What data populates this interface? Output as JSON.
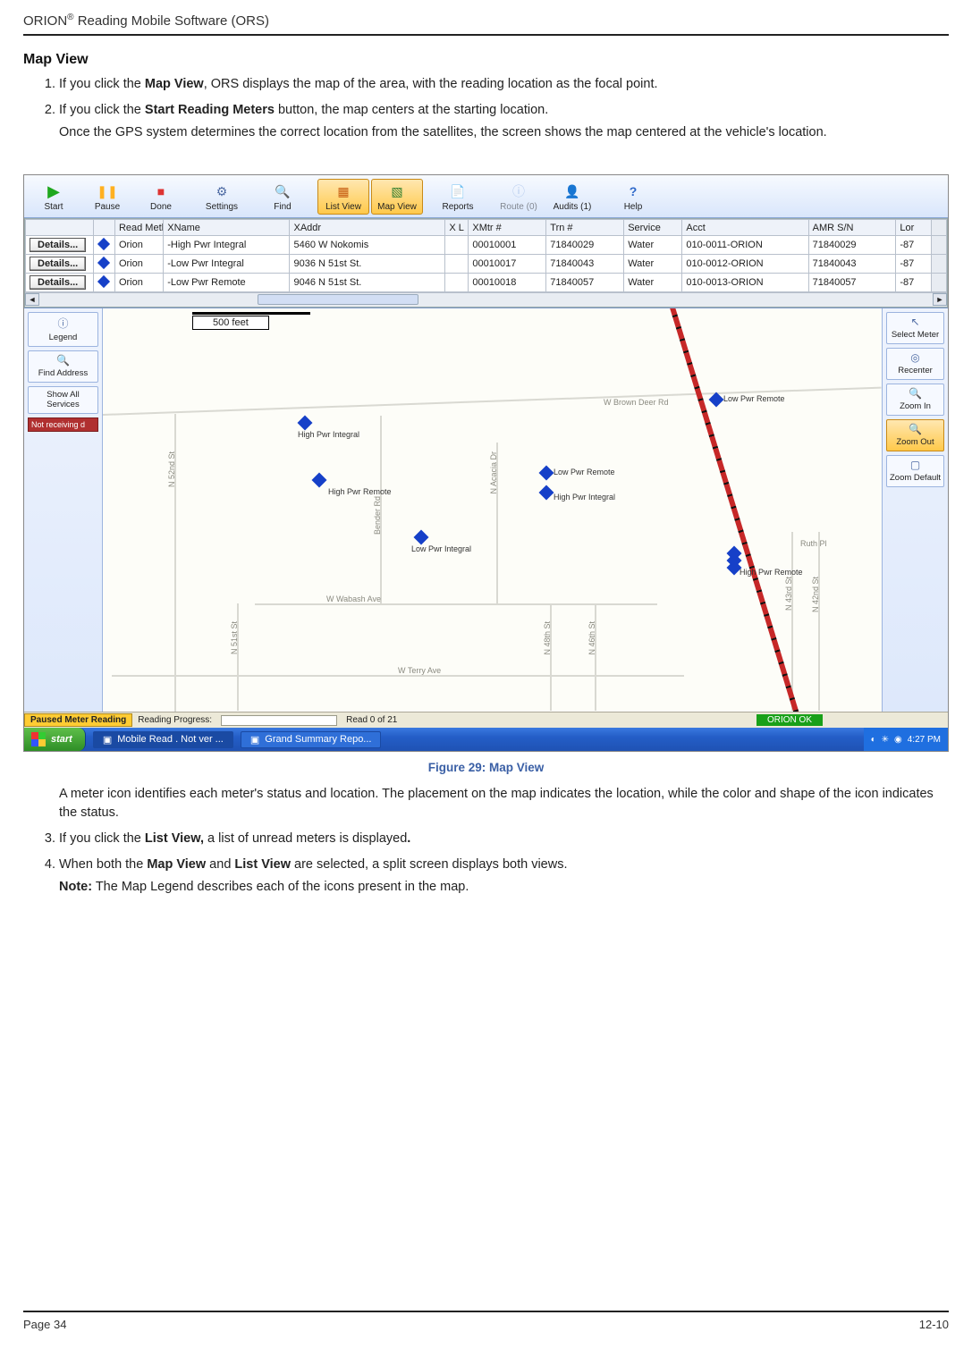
{
  "doc": {
    "header_prefix": "ORION",
    "header_reg": "®",
    "header_suffix": " Reading Mobile Software (ORS)",
    "page_left": "Page 34",
    "page_right": "12-10"
  },
  "section": {
    "title": "Map View"
  },
  "steps": {
    "s1a": "If you click the ",
    "s1b": "Map View",
    "s1c": ", ORS displays the map of the area, with the reading location as the focal point.",
    "s2a": "If you click the ",
    "s2b": "Start Reading Meters",
    "s2c": " button, the map centers at the starting location.",
    "s2_sub": "Once the GPS system determines the correct location from the satellites, the screen shows the map centered at the vehicle's location.",
    "s3a": "If you click the ",
    "s3b": "List View,",
    "s3c": " a list of unread meters is displayed",
    "s3d": ".",
    "s4a": "When both the ",
    "s4b": "Map View",
    "s4c": " and ",
    "s4d": "List View",
    "s4e": " are selected, a split screen displays both views."
  },
  "after": {
    "meter_icon_text": "A meter icon identifies each meter's status and location. The placement on the map indicates the location, while the color and shape of the icon indicates the status."
  },
  "note": {
    "label": "Note:",
    "text": " The Map Legend describes each of the icons  present in the map."
  },
  "figure": {
    "caption": "Figure 29:  Map View"
  },
  "toolbar": {
    "start": "Start",
    "pause": "Pause",
    "done": "Done",
    "settings": "Settings",
    "find": "Find",
    "listview": "List View",
    "mapview": "Map View",
    "reports": "Reports",
    "route": "Route (0)",
    "audits": "Audits (1)",
    "help": "Help"
  },
  "grid": {
    "headers": {
      "details": "",
      "icon": "",
      "readmethod": "Read Method",
      "xname": "XName",
      "xaddr": "XAddr",
      "xl": "X L",
      "xmtr": "XMtr #",
      "trn": "Trn #",
      "service": "Service",
      "acct": "Acct",
      "amr": "AMR S/N",
      "lor": "Lor"
    },
    "details_label": "Details...",
    "rows": [
      {
        "rm": "Orion",
        "xn": "-High Pwr Integral",
        "xa": "5460 W Nokomis",
        "xm": "00010001",
        "tr": "71840029",
        "sv": "Water",
        "ac": "010-0011-ORION",
        "am": "71840029",
        "lo": "-87"
      },
      {
        "rm": "Orion",
        "xn": "-Low Pwr Integral",
        "xa": "9036 N 51st St.",
        "xm": "00010017",
        "tr": "71840043",
        "sv": "Water",
        "ac": "010-0012-ORION",
        "am": "71840043",
        "lo": "-87"
      },
      {
        "rm": "Orion",
        "xn": "-Low Pwr Remote",
        "xa": "9046 N 51st St.",
        "xm": "00010018",
        "tr": "71840057",
        "sv": "Water",
        "ac": "010-0013-ORION",
        "am": "71840057",
        "lo": "-87"
      }
    ]
  },
  "leftbar": {
    "legend": "Legend",
    "findaddr": "Find Address",
    "showall": "Show All Services",
    "notrecv": "Not receiving d"
  },
  "rightbar": {
    "select": "Select Meter",
    "recenter": "Recenter",
    "zoomin": "Zoom In",
    "zoomout": "Zoom Out",
    "zoomdef": "Zoom Default"
  },
  "map": {
    "scale": "500 feet",
    "streets": {
      "brown": "W Brown Deer Rd",
      "wabash": "W Wabash Ave",
      "terry": "W Terry Ave",
      "n52": "N 52nd St",
      "n51": "N 51st St",
      "bender": "Bender Rd",
      "acacia": "N Acacia Dr",
      "n48": "N 48th St",
      "n46": "N 46th St",
      "n43": "N 43rd St",
      "n42": "N 42nd St",
      "ruth": "Ruth Pl"
    },
    "markers": {
      "m1": "High Pwr Integral",
      "m2": "High Pwr Remote",
      "m3": "Low Pwr Integral",
      "m4": "Low Pwr Remote",
      "m5": "High Pwr Integral",
      "m6": "Low Pwr Remote",
      "m7": "High Pwr Remote"
    }
  },
  "statusbar": {
    "paused": "Paused Meter Reading",
    "rp": "Reading Progress:",
    "read": "Read 0 of 21",
    "ok": "ORION OK"
  },
  "taskbar": {
    "start": "start",
    "app1": "Mobile Read . Not ver ...",
    "app2": "Grand Summary Repo...",
    "clock": "4:27 PM"
  }
}
